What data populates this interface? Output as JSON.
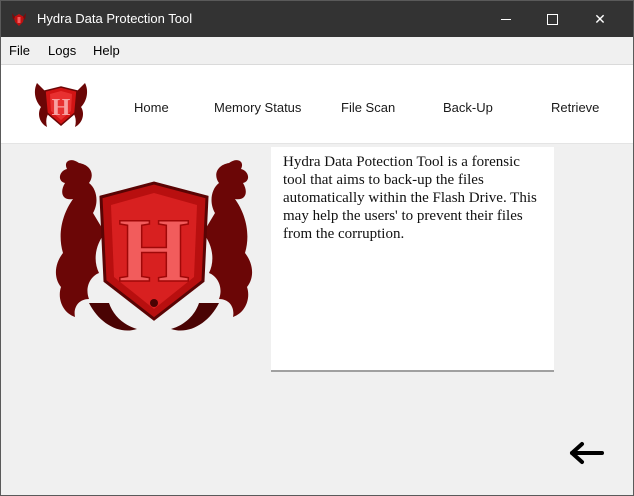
{
  "window": {
    "title": "Hydra Data Protection Tool",
    "close_glyph": "✕"
  },
  "menu": {
    "items": [
      "File",
      "Logs",
      "Help"
    ]
  },
  "nav": {
    "logo_letter": "H",
    "links": [
      "Home",
      "Memory Status",
      "File Scan",
      "Back-Up",
      "Retrieve"
    ]
  },
  "content": {
    "logo_letter": "H",
    "description": "Hydra Data Potection Tool is a forensic tool that aims to back-up the files automatically within the Flash Drive. This may help the users' to prevent their files from the corruption.",
    "back_icon": "left-arrow-icon"
  },
  "colors": {
    "titlebar": "#333333",
    "logo_dark": "#6b0606",
    "logo_red": "#d21414",
    "logo_light": "#f25c5c"
  }
}
